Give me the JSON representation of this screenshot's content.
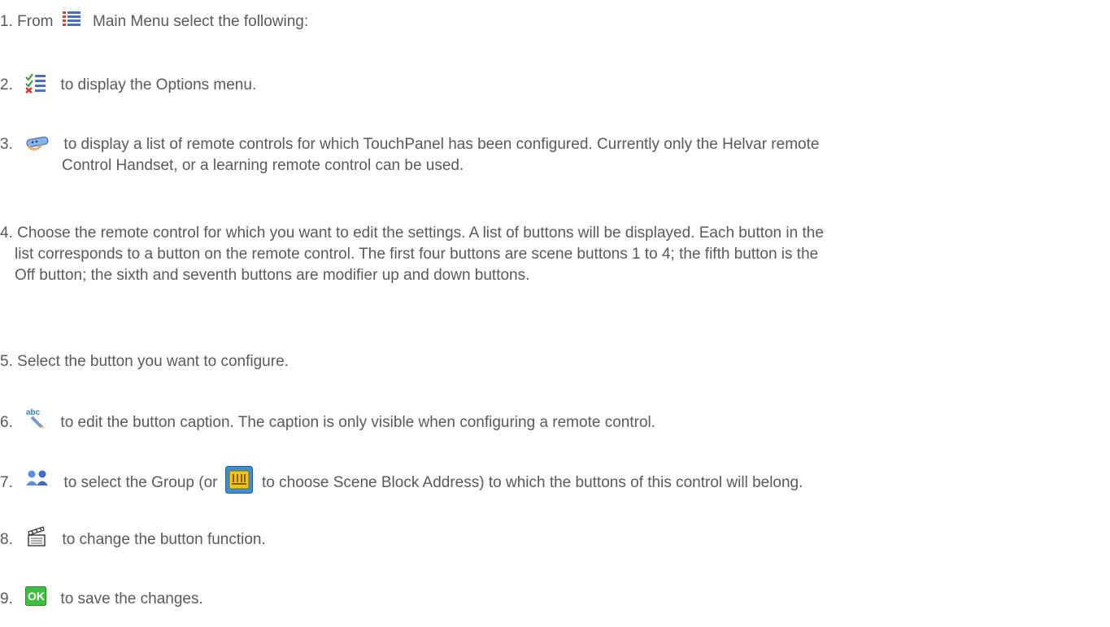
{
  "steps": [
    {
      "number": "1.",
      "parts": [
        "From",
        "Main Menu select the following:"
      ],
      "icon": "main-menu-icon"
    },
    {
      "number": "2.",
      "text": "to display the Options menu.",
      "icon": "options-icon"
    },
    {
      "number": "3.",
      "line1": "to display a list of remote controls for which TouchPanel has been configured. Currently only the Helvar remote",
      "line2": "Control Handset, or a learning remote control can be used.",
      "icon": "remote-control-icon"
    },
    {
      "number": "4.",
      "line1": "Choose the remote control for which you want to edit the settings. A list of buttons will be displayed. Each button in the",
      "line2": "list corresponds to a button on the remote control. The first four buttons are scene buttons 1 to 4; the fifth button is the",
      "line3": "Off button; the sixth and seventh buttons are modifier up and down buttons."
    },
    {
      "number": "5.",
      "text": "Select the button you want to configure."
    },
    {
      "number": "6.",
      "text": "to edit the button caption. The caption is only visible when configuring a remote control.",
      "icon": "edit-caption-icon"
    },
    {
      "number": "7.",
      "part1": "to select the Group (or",
      "part2": "to choose Scene Block Address) to which the buttons of this control will belong.",
      "icon": "group-icon",
      "icon2": "scene-block-icon"
    },
    {
      "number": "8.",
      "text": "to change the button function.",
      "icon": "clapperboard-icon"
    },
    {
      "number": "9.",
      "text": "to save the changes.",
      "icon": "ok-icon",
      "ok_label": "OK"
    }
  ],
  "colors": {
    "text": "#5a5a5a",
    "menu_blue": "#4a6fc8",
    "ok_green": "#3fbf3f",
    "scene_blue": "#3a8fd6"
  }
}
